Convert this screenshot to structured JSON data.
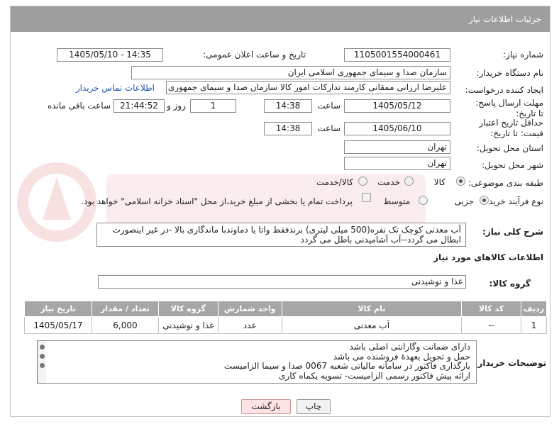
{
  "header": {
    "title": "جزئیات اطلاعات نیاز"
  },
  "fields": {
    "need_number_label": "شماره نیاز:",
    "need_number": "1105001554000461",
    "announce_label": "تاریخ و ساعت اعلان عمومی:",
    "announce_value": "1405/05/10 - 14:35",
    "buyer_org_label": "نام دستگاه خریدار:",
    "buyer_org": "سازمان صدا و سیمای جمهوری اسلامی ایران",
    "creator_label": "ایجاد کننده درخواست:",
    "creator": "علیرضا ارزانی ممقانی کارمند تدارکات امور کالا سازمان صدا و سیمای جمهوری ا",
    "contact_link": "اطلاعات تماس خریدار",
    "deadline_label": "مهلت ارسال پاسخ: تا تاریخ:",
    "deadline_date": "1405/05/12",
    "time_label": "ساعت",
    "deadline_time": "14:38",
    "days_label": "روز و",
    "days_value": "1",
    "remaining_value": "21:44:52",
    "remaining_label": "ساعت باقی مانده",
    "price_validity_label": "حداقل تاریخ اعتبار قیمت: تا تاریخ:",
    "price_validity_date": "1405/06/10",
    "price_validity_time": "14:38",
    "province_label": "استان محل تحویل:",
    "province": "تهران",
    "city_label": "شهر محل تحویل:",
    "city": "تهران",
    "category_label": "طبقه بندی موضوعی:",
    "category_options": [
      "کالا",
      "خدمت",
      "کالا/خدمت"
    ],
    "process_label": "نوع فرآیند خرید :",
    "process_options": [
      "جزیی",
      "متوسط"
    ],
    "payment_note": "پرداخت تمام یا بخشی از مبلغ خرید،از محل \"اسناد خزانه اسلامی\" خواهد بود."
  },
  "description": {
    "label": "شرح کلی نیاز:",
    "text": "آب معدنی کوچک تک نفره(500 میلی لیتری) برندفقط واتا یا دماوندبا ماندگاری بالا -در غیر اینصورت ابطال می گردد--آب آشامیدنی باطل می گردد"
  },
  "goods": {
    "section_title": "اطلاعات کالاهای مورد نیاز",
    "group_label": "گروه کالا:",
    "group_value": "غذا و نوشیدنی",
    "columns": [
      "ردیف",
      "کد کالا",
      "نام کالا",
      "واحد شمارش",
      "گروه کالا",
      "تعداد / مقدار",
      "تاریخ نیاز"
    ],
    "rows": [
      [
        "1",
        "--",
        "آب معدنی",
        "عدد",
        "غذا و نوشیدنی",
        "6,000",
        "1405/05/17"
      ]
    ]
  },
  "buyer_notes": {
    "label": "توضیحات خریدار:",
    "lines": [
      "دارای ضمانت وگارانتی اصلی باشد",
      "حمل و تحویل بعهدهٔ فروشنده می باشد",
      "بارگذاری فاکتور در سامانه مالیاتی شعبه 0067 صدا و سیما الزامیست",
      "ارائه پیش فاکتور رسمی الزامیست- تسویه یکماه کاری"
    ]
  },
  "buttons": {
    "print": "چاپ",
    "back": "بازگشت"
  },
  "colors": {
    "header_bg": "#9e9e9e",
    "link": "#2255aa",
    "back_btn": "#fde3e3"
  }
}
